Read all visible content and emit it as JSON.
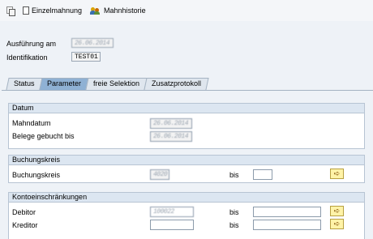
{
  "toolbar": {
    "copy_icon": "copy-icon",
    "einzelmahnung_label": "Einzelmahnung",
    "mahnhistorie_label": "Mahnhistorie"
  },
  "header": {
    "ausfuehrung_label": "Ausführung am",
    "ausfuehrung_value": "26.06.2014",
    "identifikation_label": "Identifikation",
    "identifikation_value": "TEST01"
  },
  "tabs": [
    {
      "label": "Status"
    },
    {
      "label": "Parameter"
    },
    {
      "label": "freie Selektion"
    },
    {
      "label": "Zusatzprotokoll"
    }
  ],
  "groups": {
    "datum": {
      "title": "Datum",
      "mahndatum_label": "Mahndatum",
      "mahndatum_value": "26.06.2014",
      "belege_label": "Belege gebucht bis",
      "belege_value": "26.06.2014"
    },
    "buchungskreis": {
      "title": "Buchungskreis",
      "label": "Buchungskreis",
      "from_value": "4020",
      "bis_label": "bis",
      "to_value": ""
    },
    "konto": {
      "title": "Kontoeinschränkungen",
      "debitor_label": "Debitor",
      "debitor_value": "100022",
      "debitor_bis": "bis",
      "kreditor_label": "Kreditor",
      "kreditor_value": "",
      "kreditor_bis": "bis"
    }
  },
  "colors": {
    "active_tab": "#8fb1d4",
    "group_header": "#dce6f1",
    "arrow_button": "#fff3a8"
  }
}
